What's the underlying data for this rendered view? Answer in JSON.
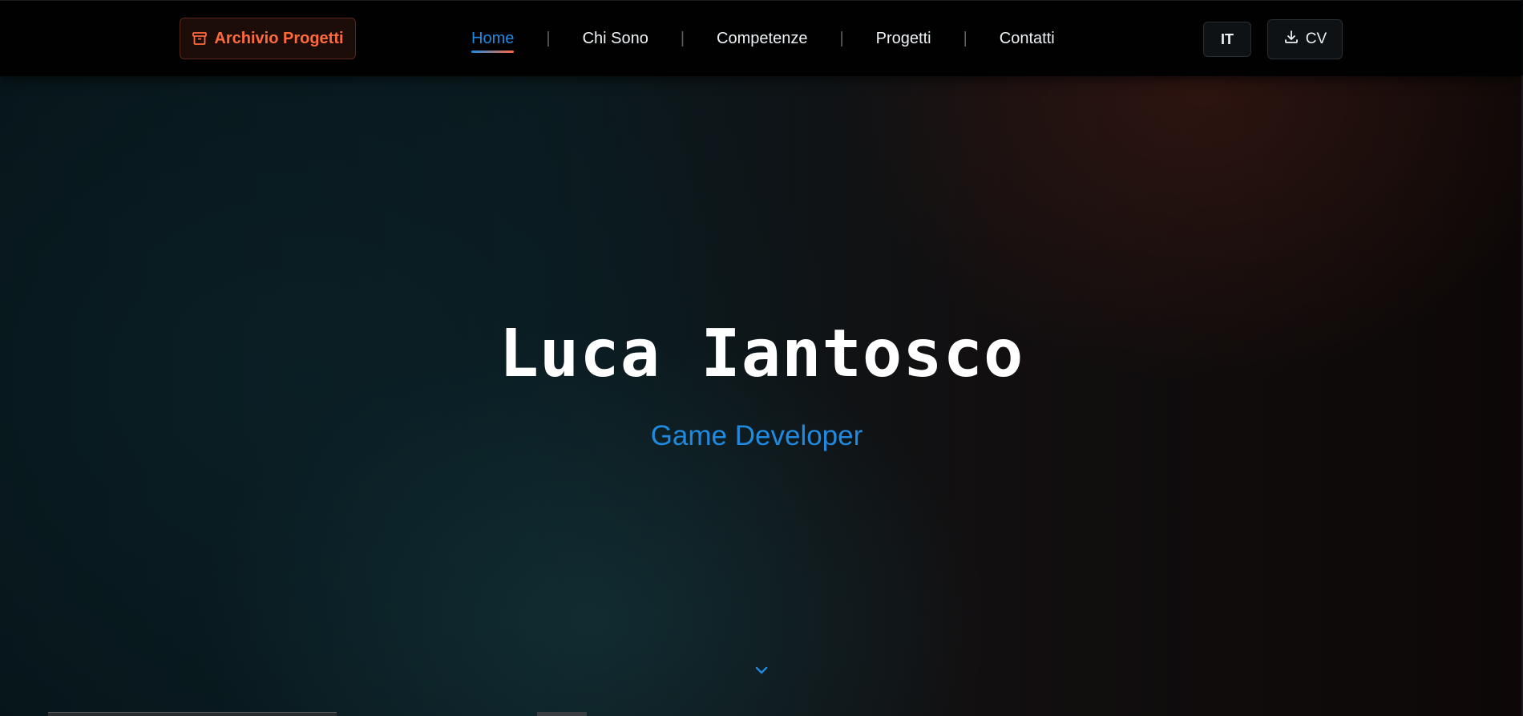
{
  "header": {
    "archive_label": "Archivio Progetti",
    "nav": [
      {
        "label": "Home",
        "active": true
      },
      {
        "label": "Chi Sono",
        "active": false
      },
      {
        "label": "Competenze",
        "active": false
      },
      {
        "label": "Progetti",
        "active": false
      },
      {
        "label": "Contatti",
        "active": false
      }
    ],
    "separator": "|",
    "lang_label": "IT",
    "cv_label": "CV"
  },
  "hero": {
    "title": "Luca Iantosco",
    "subtitle": "Game Developer"
  },
  "icons": {
    "archive": "archive-box-icon",
    "download": "download-icon",
    "scroll": "chevron-down-icon"
  },
  "colors": {
    "accent_blue": "#1f8ae0",
    "accent_orange": "#ff6a3d",
    "header_bg": "#010101"
  }
}
